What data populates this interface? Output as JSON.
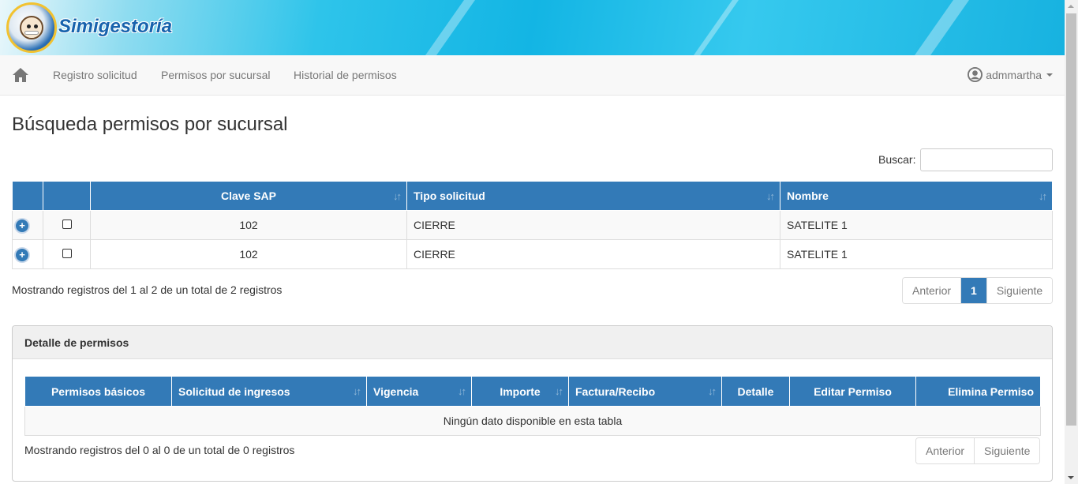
{
  "brand": {
    "name": "Simigestoría",
    "logo_icon": "mascot-logo-icon"
  },
  "navbar": {
    "home_icon": "home-icon",
    "links": [
      "Registro solicitud",
      "Permisos por sucursal",
      "Historial de permisos"
    ],
    "user": "admmartha",
    "user_icon": "user-circle-icon"
  },
  "page": {
    "title": "Búsqueda permisos por sucursal"
  },
  "search": {
    "label": "Buscar:",
    "value": ""
  },
  "main_table": {
    "columns": [
      "",
      "",
      "Clave SAP",
      "Tipo solicitud",
      "Nombre"
    ],
    "rows": [
      {
        "clave_sap": "102",
        "tipo": "CIERRE",
        "nombre": "SATELITE 1",
        "checked": false
      },
      {
        "clave_sap": "102",
        "tipo": "CIERRE",
        "nombre": "SATELITE 1",
        "checked": false
      }
    ],
    "info": "Mostrando registros del 1 al 2 de un total de 2 registros",
    "pager": {
      "prev": "Anterior",
      "page": "1",
      "next": "Siguiente"
    }
  },
  "detail_panel": {
    "title": "Detalle de permisos",
    "columns": [
      "Permisos básicos",
      "Solicitud de ingresos",
      "Vigencia",
      "Importe",
      "Factura/Recibo",
      "Detalle",
      "Editar Permiso",
      "Elimina Permiso"
    ],
    "empty": "Ningún dato disponible en esta tabla",
    "info": "Mostrando registros del 0 al 0 de un total de 0 registros",
    "pager": {
      "prev": "Anterior",
      "next": "Siguiente"
    }
  },
  "colors": {
    "primary": "#337ab7",
    "banner": "#13b5e4",
    "brand_text": "#1763ad"
  }
}
